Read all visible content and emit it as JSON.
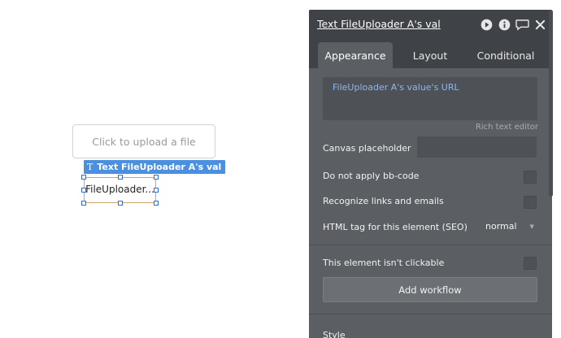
{
  "canvas": {
    "upload_placeholder": "Click to upload a file",
    "selection_tag": {
      "icon": "text-t-icon",
      "label": "Text FileUploader A's val"
    },
    "selected_element_text": "FileUploader..."
  },
  "panel": {
    "title": "Text FileUploader A's val",
    "header_icons": [
      "play-icon",
      "info-icon",
      "comment-icon",
      "close-icon"
    ],
    "tabs": [
      {
        "label": "Appearance",
        "active": true
      },
      {
        "label": "Layout",
        "active": false
      },
      {
        "label": "Conditional",
        "active": false
      }
    ],
    "content_value": "FileUploader A's value's URL",
    "rich_text_label": "Rich text editor",
    "canvas_placeholder_label": "Canvas placeholder",
    "canvas_placeholder_value": "",
    "bbcode_label": "Do not apply bb-code",
    "bbcode_checked": false,
    "links_label": "Recognize links and emails",
    "links_checked": false,
    "html_tag_label": "HTML tag for this element (SEO)",
    "html_tag_value": "normal",
    "not_clickable_label": "This element isn't clickable",
    "not_clickable_checked": false,
    "add_workflow_label": "Add workflow",
    "style_section_label": "Style"
  },
  "colors": {
    "panel_bg": "#5b5f64",
    "header_bg": "#3f4347",
    "tag_blue": "#4a8fe0",
    "dynamic_text": "#8ab8ee"
  }
}
